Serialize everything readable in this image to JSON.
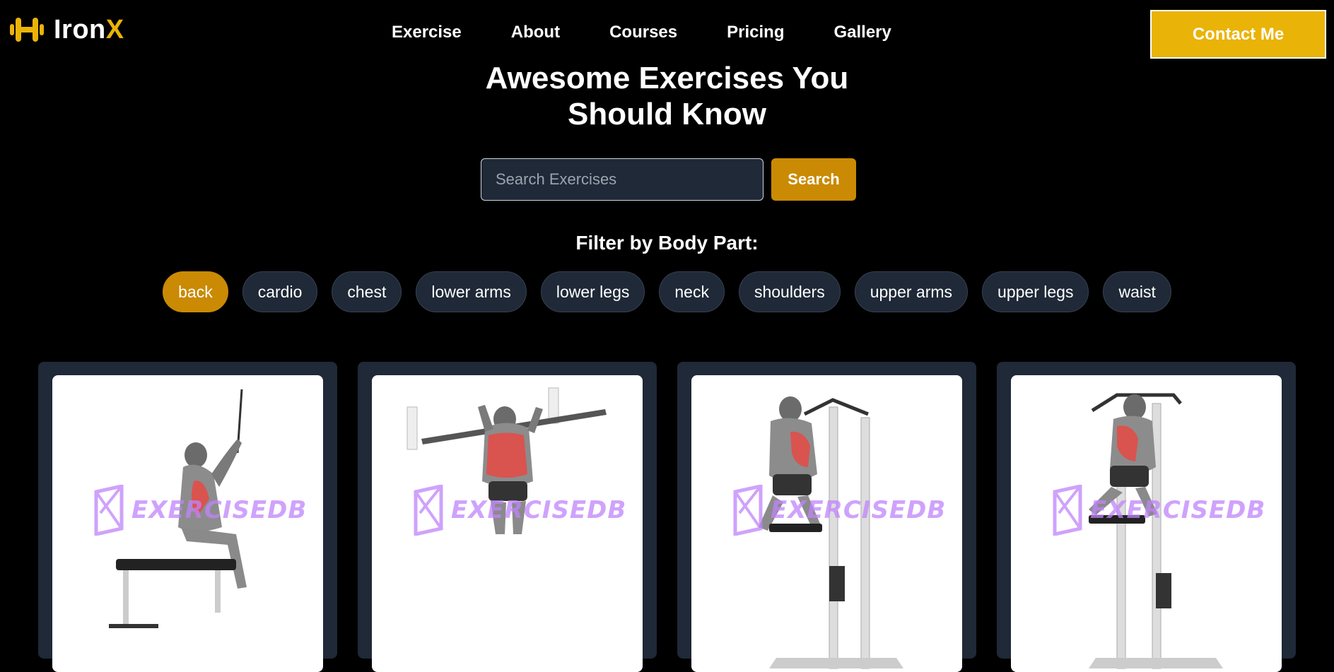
{
  "header": {
    "logo": {
      "icon": "dumbbell-icon",
      "text_main": "Iron",
      "text_accent": "X"
    },
    "nav": [
      {
        "label": "Exercise"
      },
      {
        "label": "About"
      },
      {
        "label": "Courses"
      },
      {
        "label": "Pricing"
      },
      {
        "label": "Gallery"
      }
    ],
    "contact_label": "Contact Me"
  },
  "hero": {
    "title_line1": "Awesome Exercises You",
    "title_line2": "Should Know"
  },
  "search": {
    "placeholder": "Search Exercises",
    "value": "",
    "button_label": "Search"
  },
  "filter": {
    "title": "Filter by Body Part:",
    "selected": "back",
    "chips": [
      {
        "label": "back",
        "active": true
      },
      {
        "label": "cardio",
        "active": false
      },
      {
        "label": "chest",
        "active": false
      },
      {
        "label": "lower arms",
        "active": false
      },
      {
        "label": "lower legs",
        "active": false
      },
      {
        "label": "neck",
        "active": false
      },
      {
        "label": "shoulders",
        "active": false
      },
      {
        "label": "upper arms",
        "active": false
      },
      {
        "label": "upper legs",
        "active": false
      },
      {
        "label": "waist",
        "active": false
      }
    ]
  },
  "cards": [
    {
      "watermark": "EXERCISEDB",
      "image_icon": "seated-cable-pulldown-illustration"
    },
    {
      "watermark": "EXERCISEDB",
      "image_icon": "pull-up-bar-illustration"
    },
    {
      "watermark": "EXERCISEDB",
      "image_icon": "assisted-pull-up-machine-illustration"
    },
    {
      "watermark": "EXERCISEDB",
      "image_icon": "assisted-chin-up-machine-illustration"
    }
  ],
  "colors": {
    "accent": "#eab308",
    "accent_dark": "#ca8a04",
    "surface": "#1f2937",
    "background": "#000000",
    "watermark": "#c084fc"
  }
}
